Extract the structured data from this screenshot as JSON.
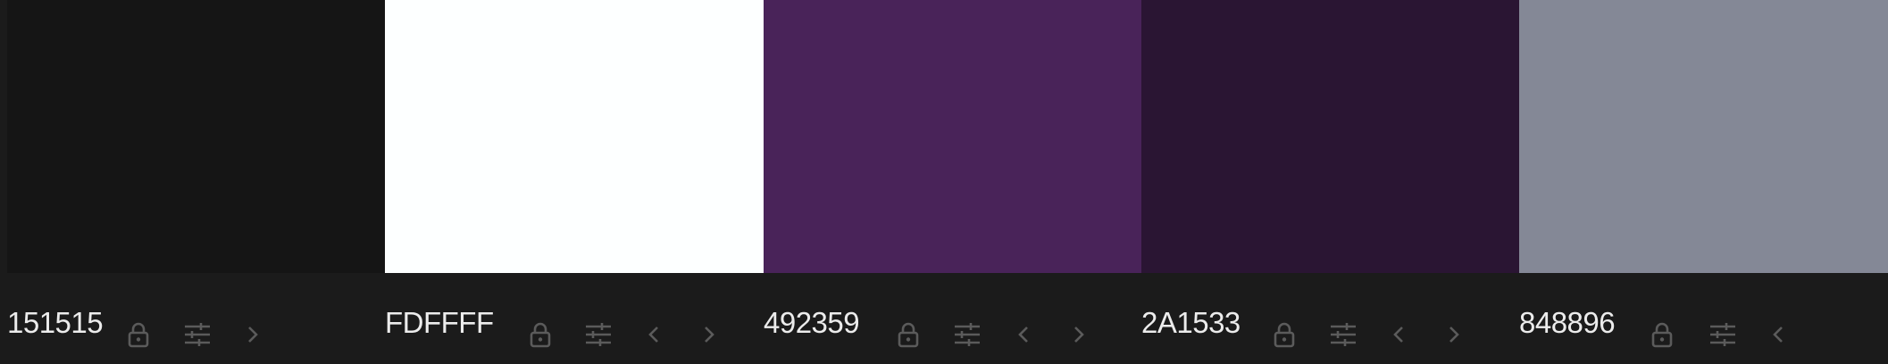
{
  "palette": {
    "swatches": [
      {
        "hex": "151515",
        "color": "#151515",
        "controls": [
          "lock-icon",
          "sliders-icon",
          "chevron-right-icon"
        ]
      },
      {
        "hex": "FDFFFF",
        "color": "#FDFFFF",
        "controls": [
          "lock-icon",
          "sliders-icon",
          "chevron-left-icon",
          "chevron-right-icon"
        ]
      },
      {
        "hex": "492359",
        "color": "#492359",
        "controls": [
          "lock-icon",
          "sliders-icon",
          "chevron-left-icon",
          "chevron-right-icon"
        ]
      },
      {
        "hex": "2A1533",
        "color": "#2A1533",
        "controls": [
          "lock-icon",
          "sliders-icon",
          "chevron-left-icon",
          "chevron-right-icon"
        ]
      },
      {
        "hex": "848896",
        "color": "#848896",
        "controls": [
          "lock-icon",
          "sliders-icon",
          "chevron-left-icon"
        ]
      }
    ],
    "colors": {
      "background": "#1b1b1b",
      "hex_text": "#ececec",
      "icon": "#5b5b5b"
    }
  }
}
